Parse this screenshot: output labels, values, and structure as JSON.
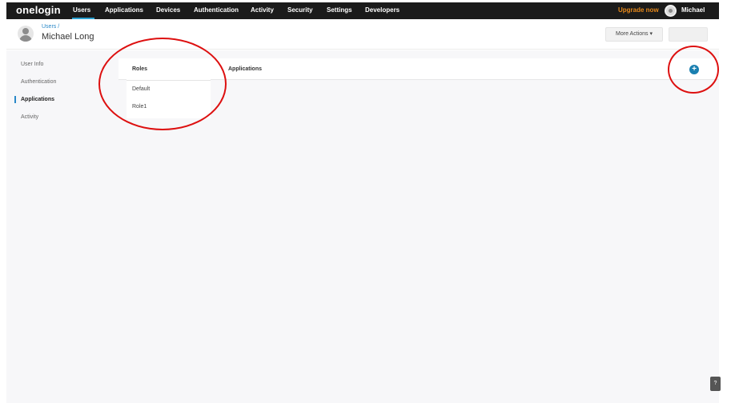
{
  "nav": {
    "logo": "onelogin",
    "items": [
      "Users",
      "Applications",
      "Devices",
      "Authentication",
      "Activity",
      "Security",
      "Settings",
      "Developers"
    ],
    "upgrade": "Upgrade now",
    "user": "Michael"
  },
  "header": {
    "breadcrumb": "Users /",
    "title": "Michael Long",
    "more_actions": "More Actions ▾"
  },
  "sidebar": {
    "items": [
      "User Info",
      "Authentication",
      "Applications",
      "Activity"
    ]
  },
  "main": {
    "roles_heading": "Roles",
    "roles": [
      "Default",
      "Role1"
    ],
    "apps_heading": "Applications",
    "add_label": "+"
  },
  "colors": {
    "accent": "#2a88c8",
    "add_button": "#1a7fb0",
    "upgrade": "#e8891a",
    "annotation": "#dd1010"
  }
}
